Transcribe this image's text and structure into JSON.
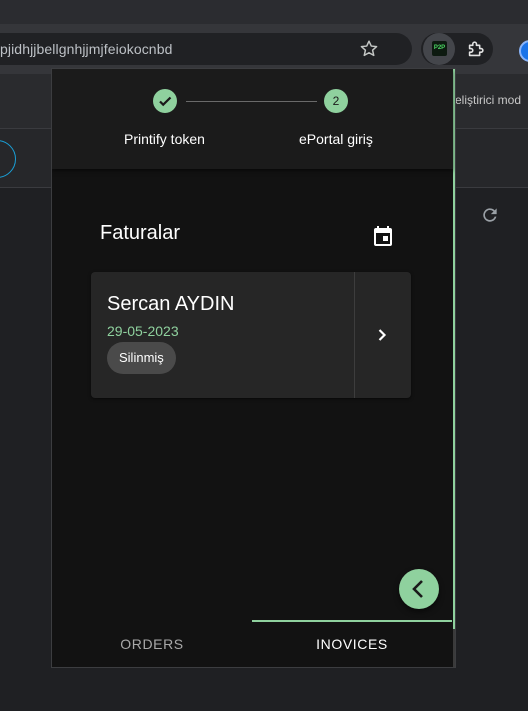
{
  "browser": {
    "url_text": "pjidhjjbellgnhjjmjfeiokocnbd",
    "extension_badge": "P2P"
  },
  "background_page": {
    "partial_text": "eliştirici mod"
  },
  "popup": {
    "stepper": {
      "steps": [
        {
          "label": "Printify token",
          "state": "completed",
          "icon": "check-icon"
        },
        {
          "label": "ePortal giriş",
          "state": "active",
          "number": "2"
        }
      ]
    },
    "section_title": "Faturalar",
    "invoices": [
      {
        "name": "Sercan AYDIN",
        "date": "29-05-2023",
        "status": "Silinmiş"
      }
    ],
    "tabs": [
      {
        "label": "ORDERS",
        "active": false
      },
      {
        "label": "INOVICES",
        "active": true
      }
    ]
  },
  "colors": {
    "accent": "#8fd19e",
    "popup_bg": "#121212",
    "card_bg": "#262626"
  }
}
